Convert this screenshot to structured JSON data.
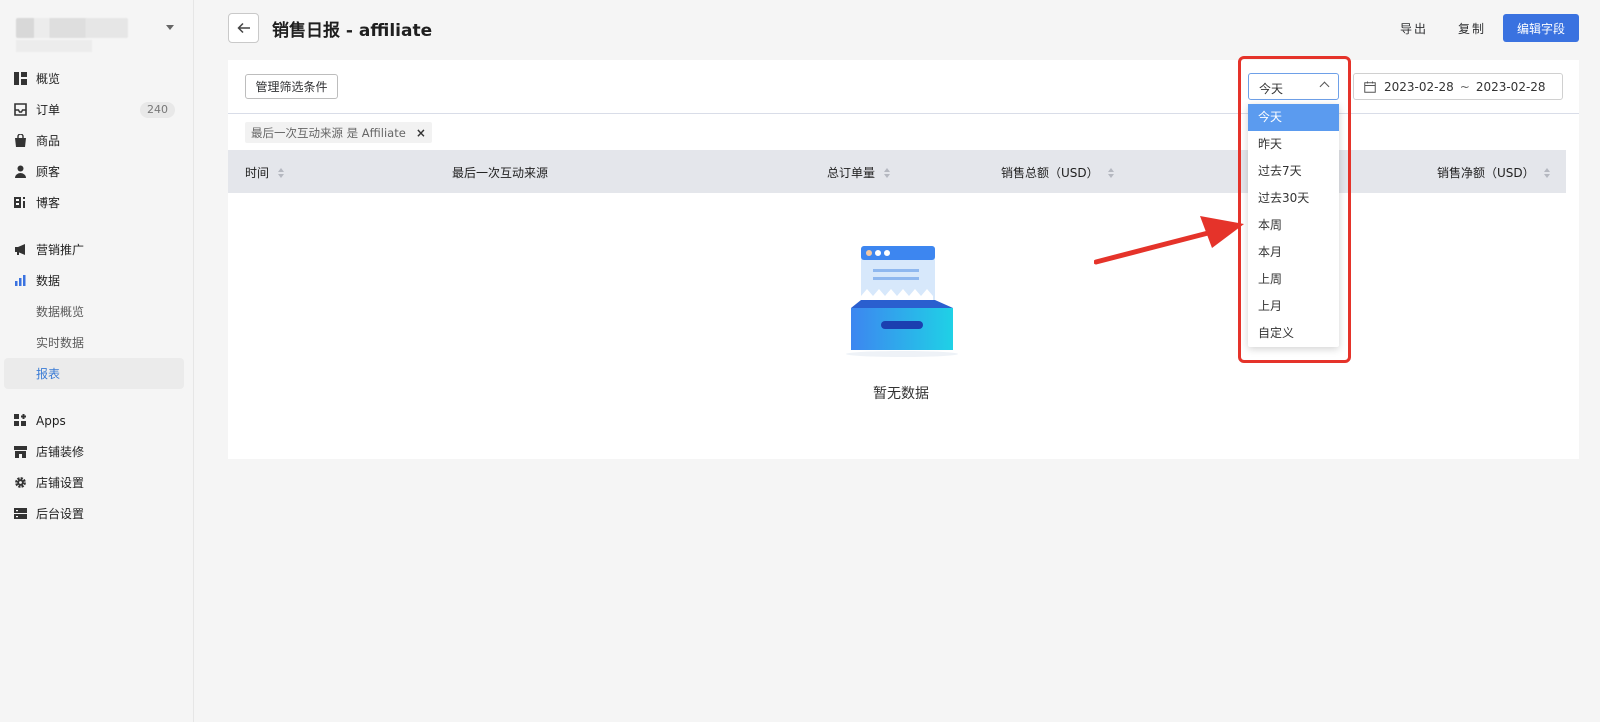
{
  "sidebar": {
    "nav": [
      {
        "label": "概览",
        "icon": "overview-icon"
      },
      {
        "label": "订单",
        "icon": "inbox-icon",
        "badge": "240"
      },
      {
        "label": "商品",
        "icon": "bag-icon"
      },
      {
        "label": "顾客",
        "icon": "user-icon"
      },
      {
        "label": "博客",
        "icon": "blog-icon"
      }
    ],
    "nav2": [
      {
        "label": "营销推广",
        "icon": "megaphone-icon"
      },
      {
        "label": "数据",
        "icon": "bar-chart-icon"
      }
    ],
    "data_sub": [
      {
        "label": "数据概览"
      },
      {
        "label": "实时数据"
      },
      {
        "label": "报表",
        "active": true
      }
    ],
    "nav3": [
      {
        "label": "Apps",
        "icon": "apps-icon"
      },
      {
        "label": "店铺装修",
        "icon": "store-icon"
      },
      {
        "label": "店铺设置",
        "icon": "gear-icon"
      },
      {
        "label": "后台设置",
        "icon": "server-icon"
      }
    ]
  },
  "header": {
    "title": "销售日报 - affiliate",
    "export_label": "导出",
    "copy_label": "复制",
    "edit_fields_label": "编辑字段"
  },
  "toolbar": {
    "manage_filters_label": "管理筛选条件",
    "period_select_value": "今天",
    "date_start": "2023-02-28",
    "date_sep": "~",
    "date_end": "2023-02-28"
  },
  "filter_chip": {
    "label": "最后一次互动来源 是 Affiliate",
    "remove": "×"
  },
  "table": {
    "columns": [
      "时间",
      "最后一次互动来源",
      "总订单量",
      "销售总额（USD）",
      "销售净额（USD）"
    ]
  },
  "empty_state": {
    "text": "暂无数据"
  },
  "dropdown": {
    "options": [
      "今天",
      "昨天",
      "过去7天",
      "过去30天",
      "本周",
      "本月",
      "上周",
      "上月",
      "自定义"
    ],
    "selected": "今天"
  },
  "colors": {
    "primary": "#3a72e0",
    "highlight_annotation": "#e5332a",
    "dropdown_active": "#5b9bef"
  }
}
